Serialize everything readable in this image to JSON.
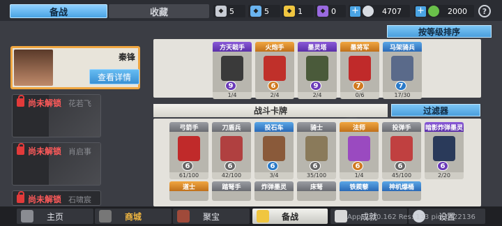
{
  "tabs": {
    "active": "备战",
    "inactive": "收藏"
  },
  "resources": [
    {
      "icon": "silver-shield-icon",
      "value": "5",
      "color": "#c8ccd4"
    },
    {
      "icon": "blue-shield-icon",
      "value": "5",
      "color": "#6ab4f0"
    },
    {
      "icon": "gold-shield-icon",
      "value": "1",
      "color": "#f0c640"
    },
    {
      "icon": "purple-shield-icon",
      "value": "0",
      "color": "#9a6ae0"
    }
  ],
  "currency": {
    "silver": "4707",
    "gold": "2000"
  },
  "sort_label": "按等级排序",
  "hero": {
    "name": "秦锋",
    "detail_label": "查看详情"
  },
  "locked_heroes": [
    {
      "lock_label": "尚未解锁",
      "name": "花若飞"
    },
    {
      "lock_label": "尚未解锁",
      "name": "肖启事"
    },
    {
      "lock_label": "尚未解锁",
      "name": "石啸宸"
    }
  ],
  "deck": [
    {
      "name": "方天戟手",
      "rarity": "purple",
      "cost": "9",
      "count": "1/4",
      "color": "#3a3a3a"
    },
    {
      "name": "火炮手",
      "rarity": "orange",
      "cost": "6",
      "count": "2/4",
      "color": "#c0302a"
    },
    {
      "name": "墨灵塔",
      "rarity": "purple",
      "cost": "9",
      "count": "2/4",
      "color": "#4a5a3a"
    },
    {
      "name": "墨将军",
      "rarity": "orange",
      "cost": "7",
      "count": "0/6",
      "color": "#c02a2a"
    },
    {
      "name": "马架骑兵",
      "rarity": "blue",
      "cost": "7",
      "count": "17/30",
      "color": "#5a6a8a"
    }
  ],
  "battle_cards_title": "战斗卡牌",
  "filter_label": "过滤器",
  "cards": [
    {
      "name": "弓箭手",
      "rarity": "gray",
      "cost": "6",
      "count": "61/100",
      "color": "#c02a2a"
    },
    {
      "name": "刀盾兵",
      "rarity": "gray",
      "cost": "6",
      "count": "42/100",
      "color": "#b04040"
    },
    {
      "name": "投石车",
      "rarity": "blue",
      "cost": "6",
      "count": "3/4",
      "color": "#8a5a3a"
    },
    {
      "name": "骑士",
      "rarity": "gray",
      "cost": "6",
      "count": "35/100",
      "color": "#8a7a5a"
    },
    {
      "name": "法师",
      "rarity": "orange",
      "cost": "6",
      "count": "1/4",
      "color": "#9a4ac0"
    },
    {
      "name": "投弹手",
      "rarity": "gray",
      "cost": "6",
      "count": "45/100",
      "color": "#c04040"
    },
    {
      "name": "暗影炸弹墨灵",
      "rarity": "purple",
      "cost": "6",
      "count": "2/20",
      "color": "#2a3a5a"
    }
  ],
  "cards_row2": [
    {
      "name": "道士",
      "rarity": "orange"
    },
    {
      "name": "踏弩手",
      "rarity": "gray"
    },
    {
      "name": "炸弹墨灵",
      "rarity": "gray"
    },
    {
      "name": "床弩",
      "rarity": "gray"
    },
    {
      "name": "铁蒺藜",
      "rarity": "blue"
    },
    {
      "name": "神机爆桶",
      "rarity": "blue"
    }
  ],
  "nav": [
    {
      "label": "主页",
      "icon": "home-icon"
    },
    {
      "label": "商城",
      "icon": "shop-icon"
    },
    {
      "label": "聚宝",
      "icon": "treasure-icon"
    },
    {
      "label": "备战",
      "icon": "battle-prep-icon"
    },
    {
      "label": "成就",
      "icon": "achievement-icon"
    },
    {
      "label": "设置",
      "icon": "settings-icon"
    }
  ],
  "debug": "App: 1.30.162 Res: 133 pid:1422136"
}
